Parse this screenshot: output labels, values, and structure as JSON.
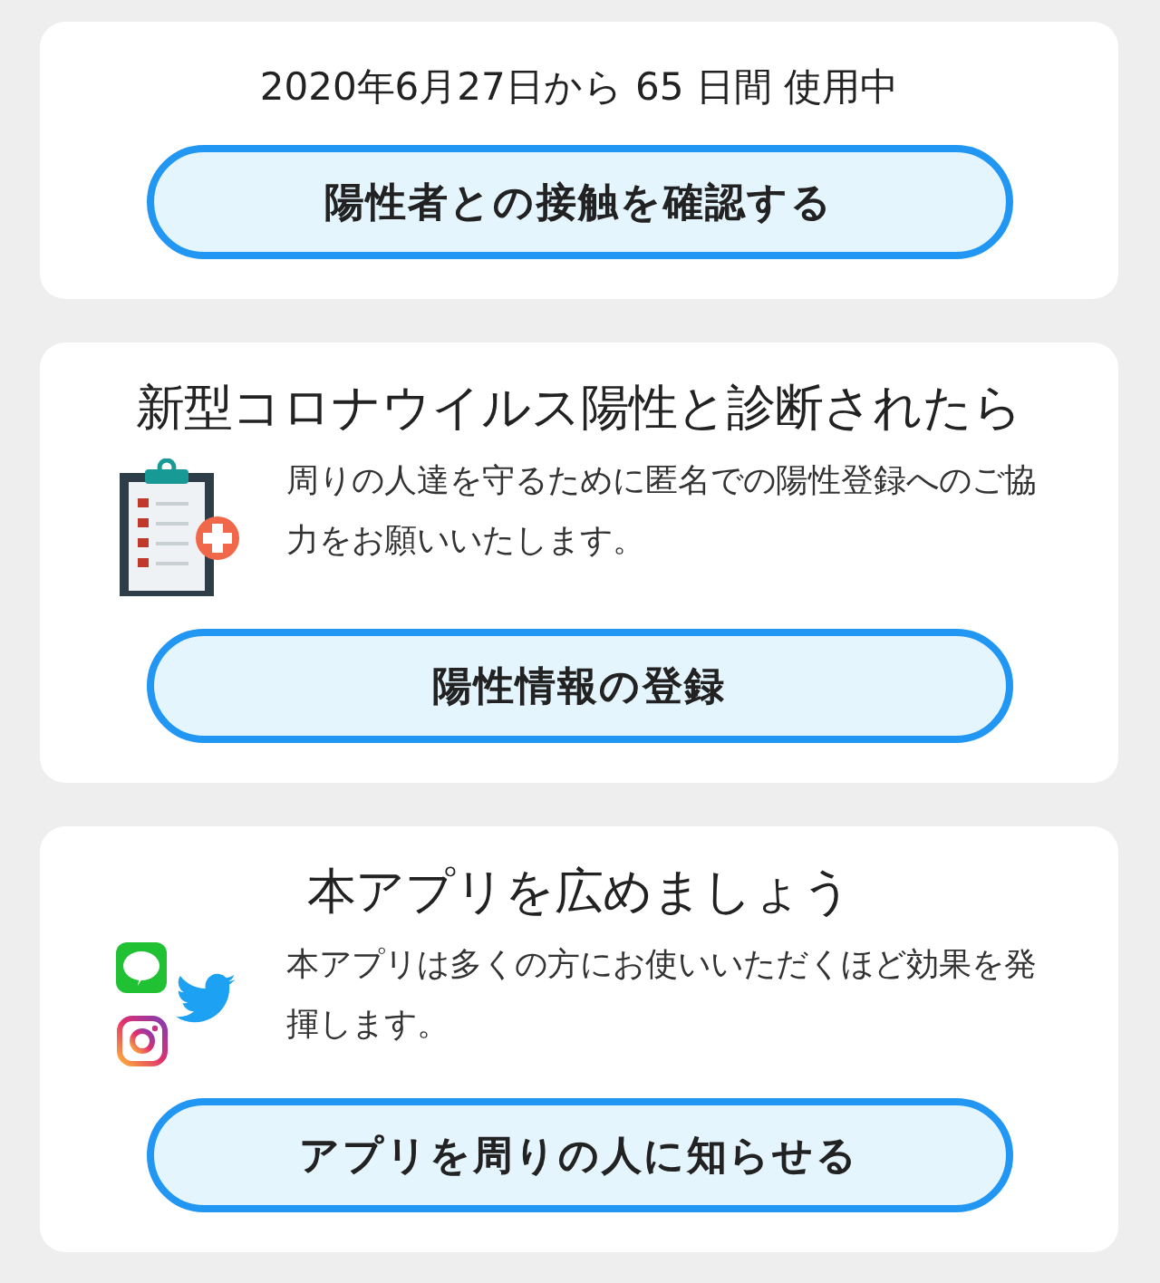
{
  "usage_card": {
    "usage_text": "2020年6月27日から 65 日間 使用中",
    "button": "陽性者との接触を確認する"
  },
  "positive_card": {
    "title": "新型コロナウイルス陽性と診断されたら",
    "description": "周りの人達を守るために匿名での陽性登録へのご協力をお願いいたします。",
    "button": "陽性情報の登録"
  },
  "share_card": {
    "title": "本アプリを広めましょう",
    "description": "本アプリは多くの方にお使いいただくほど効果を発揮します。",
    "button": "アプリを周りの人に知らせる"
  }
}
